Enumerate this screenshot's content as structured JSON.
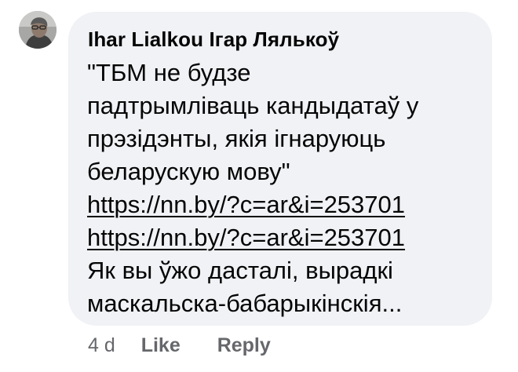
{
  "comment": {
    "author": "Ihar Lialkou Ігар Лялькоў",
    "lines": [
      "\"ТБМ не будзе",
      "падтрымліваць кандыдатаў у",
      "прэзідэнты, якія ігнаруюць",
      "беларускую мову\""
    ],
    "links": [
      "https://nn.by/?c=ar&i=253701",
      "https://nn.by/?c=ar&i=253701"
    ],
    "tail_lines": [
      "Як вы ўжо дасталі, вырадкі",
      "маскальска-бабарыкінскія..."
    ]
  },
  "actions": {
    "time": "4 d",
    "like": "Like",
    "reply": "Reply"
  },
  "colors": {
    "bubble": "#f0f2f5",
    "text": "#050505",
    "meta": "#65676b"
  },
  "icons": {
    "avatar": "profile-photo"
  }
}
